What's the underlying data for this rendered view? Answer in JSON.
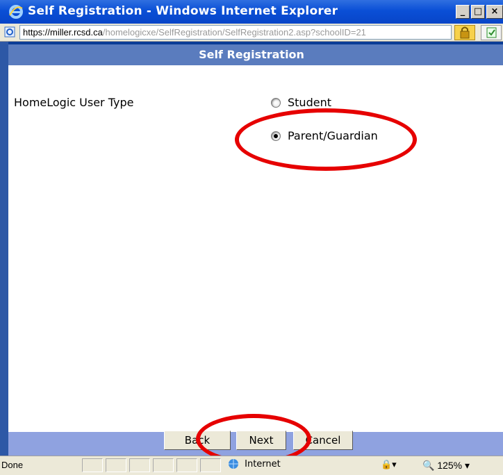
{
  "window": {
    "title": "Self Registration - Windows Internet Explorer",
    "minimize_glyph": "_",
    "restore_glyph": "□",
    "close_glyph": "×"
  },
  "address_bar": {
    "protocol": "https://",
    "host": "miller.rcsd.ca",
    "path": "/homelogicxe/SelfRegistration/SelfRegistration2.asp?schoolID=21",
    "lock_icon": "lock-icon",
    "cert_icon": "certificate-icon"
  },
  "page": {
    "header": "Self Registration",
    "field_label": "HomeLogic User Type",
    "options": [
      {
        "label": "Student",
        "checked": false
      },
      {
        "label": "Parent/Guardian",
        "checked": true
      }
    ]
  },
  "buttons": {
    "back": "Back",
    "next": "Next",
    "cancel": "Cancel"
  },
  "status_bar": {
    "status": "Done",
    "zone": "Internet",
    "zoom": "125%"
  },
  "colors": {
    "title_bar": "#0a4fd6",
    "header_band": "#5a7cbe",
    "footer_band": "#8fa2e0",
    "annotation": "#e60000"
  }
}
